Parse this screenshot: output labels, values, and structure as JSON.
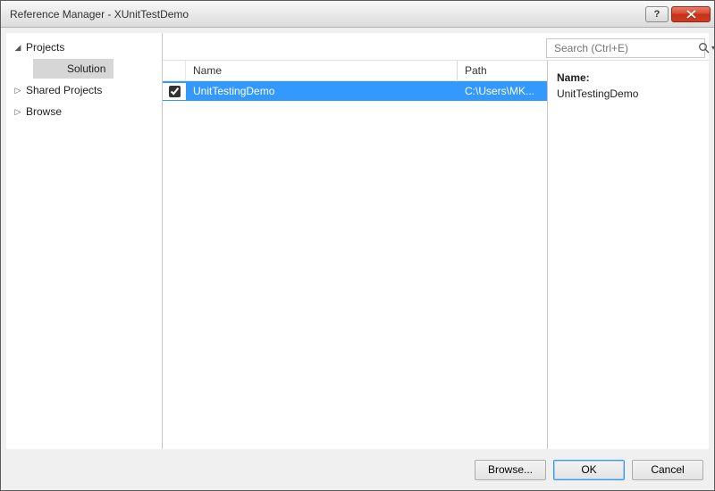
{
  "window": {
    "title": "Reference Manager - XUnitTestDemo"
  },
  "nav": {
    "items": [
      {
        "label": "Projects",
        "expanded": true,
        "children": [
          {
            "label": "Solution",
            "selected": true
          }
        ]
      },
      {
        "label": "Shared Projects",
        "expanded": false
      },
      {
        "label": "Browse",
        "expanded": false
      }
    ]
  },
  "search": {
    "placeholder": "Search (Ctrl+E)"
  },
  "grid": {
    "columns": {
      "name": "Name",
      "path": "Path"
    },
    "rows": [
      {
        "checked": true,
        "name": "UnitTestingDemo",
        "path": "C:\\Users\\MK...",
        "selected": true
      }
    ]
  },
  "details": {
    "name_label": "Name:",
    "name_value": "UnitTestingDemo"
  },
  "buttons": {
    "browse": "Browse...",
    "ok": "OK",
    "cancel": "Cancel"
  }
}
